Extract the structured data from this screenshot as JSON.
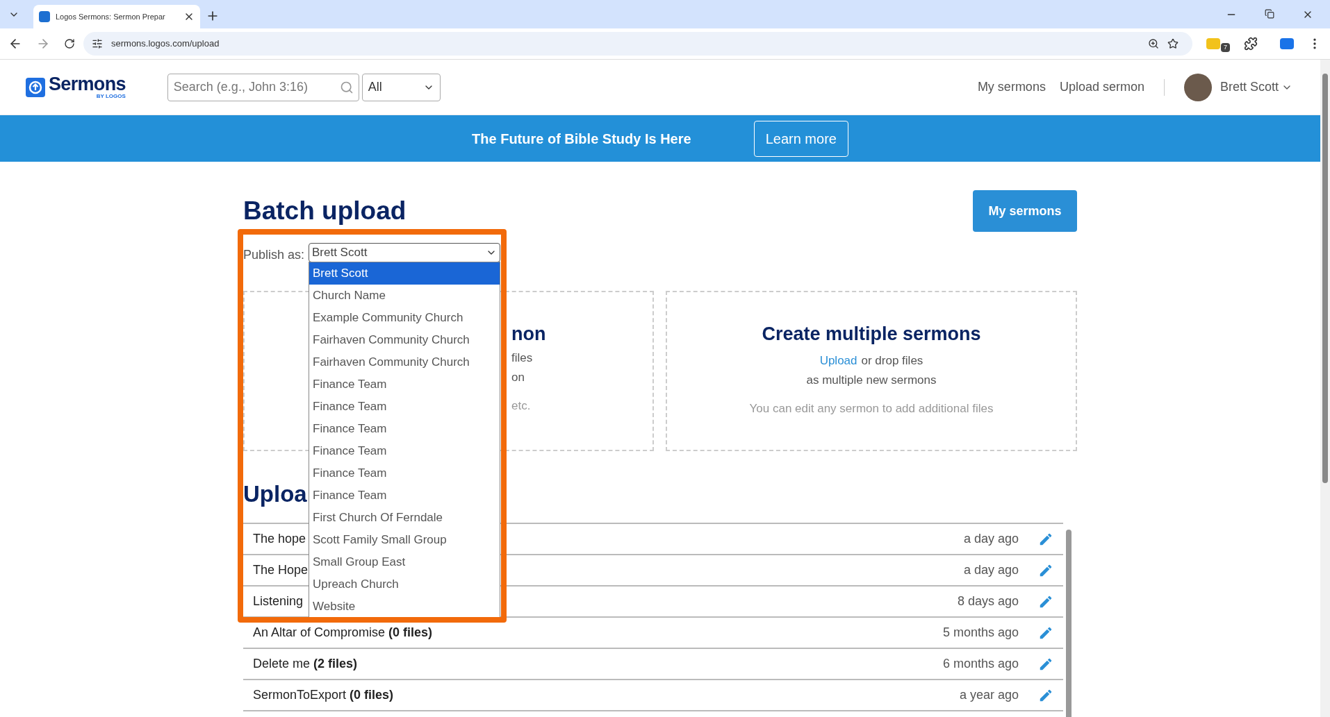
{
  "browser": {
    "tab_title": "Logos Sermons: Sermon Prepar",
    "address": "sermons.logos.com/upload",
    "extension_badge": "7"
  },
  "header": {
    "logo_text": "Sermons",
    "logo_subtext": "BY LOGOS",
    "search": {
      "placeholder": "Search (e.g., John 3:16)"
    },
    "filter": "All",
    "nav": [
      "My sermons",
      "Upload sermon"
    ],
    "user": "Brett Scott"
  },
  "banner": {
    "text": "The Future of Bible Study Is Here",
    "button": "Learn more"
  },
  "page": {
    "title": "Batch upload",
    "my_sermons_button": "My sermons"
  },
  "publish_as": {
    "label": "Publish as:",
    "value": "Brett Scott",
    "options": [
      {
        "label": "Brett Scott",
        "selected": true
      },
      {
        "label": "Church Name",
        "selected": false
      },
      {
        "label": "Example Community Church",
        "selected": false
      },
      {
        "label": "Fairhaven Community Church",
        "selected": false
      },
      {
        "label": "Fairhaven Community Church",
        "selected": false
      },
      {
        "label": "Finance Team",
        "selected": false
      },
      {
        "label": "Finance Team",
        "selected": false
      },
      {
        "label": "Finance Team",
        "selected": false
      },
      {
        "label": "Finance Team",
        "selected": false
      },
      {
        "label": "Finance Team",
        "selected": false
      },
      {
        "label": "Finance Team",
        "selected": false
      },
      {
        "label": "First Church Of Ferndale",
        "selected": false
      },
      {
        "label": "Scott Family Small Group",
        "selected": false
      },
      {
        "label": "Small Group East",
        "selected": false
      },
      {
        "label": "Upreach Church",
        "selected": false
      },
      {
        "label": "Website",
        "selected": false
      }
    ]
  },
  "left_card": {
    "heading": "non",
    "lines": [
      "files",
      "on"
    ],
    "note": "etc."
  },
  "right_card": {
    "heading": "Create multiple sermons",
    "link": "Upload",
    "line_rest": "or drop files",
    "line2": "as multiple new sermons",
    "note": "You can edit any sermon to add additional files"
  },
  "uploads": {
    "title": "Uploa",
    "rows": [
      {
        "title": "The hope",
        "time": "a day ago"
      },
      {
        "title": "The Hope",
        "time": "a day ago"
      },
      {
        "title": "Listening",
        "time": "8 days ago"
      },
      {
        "title": "An Altar of Compromise **(0 files)**",
        "time": "5 months ago"
      },
      {
        "title": "Delete me **(2 files)**",
        "time": "6 months ago"
      },
      {
        "title": "SermonToExport **(0 files)**",
        "time": "a year ago"
      }
    ]
  }
}
